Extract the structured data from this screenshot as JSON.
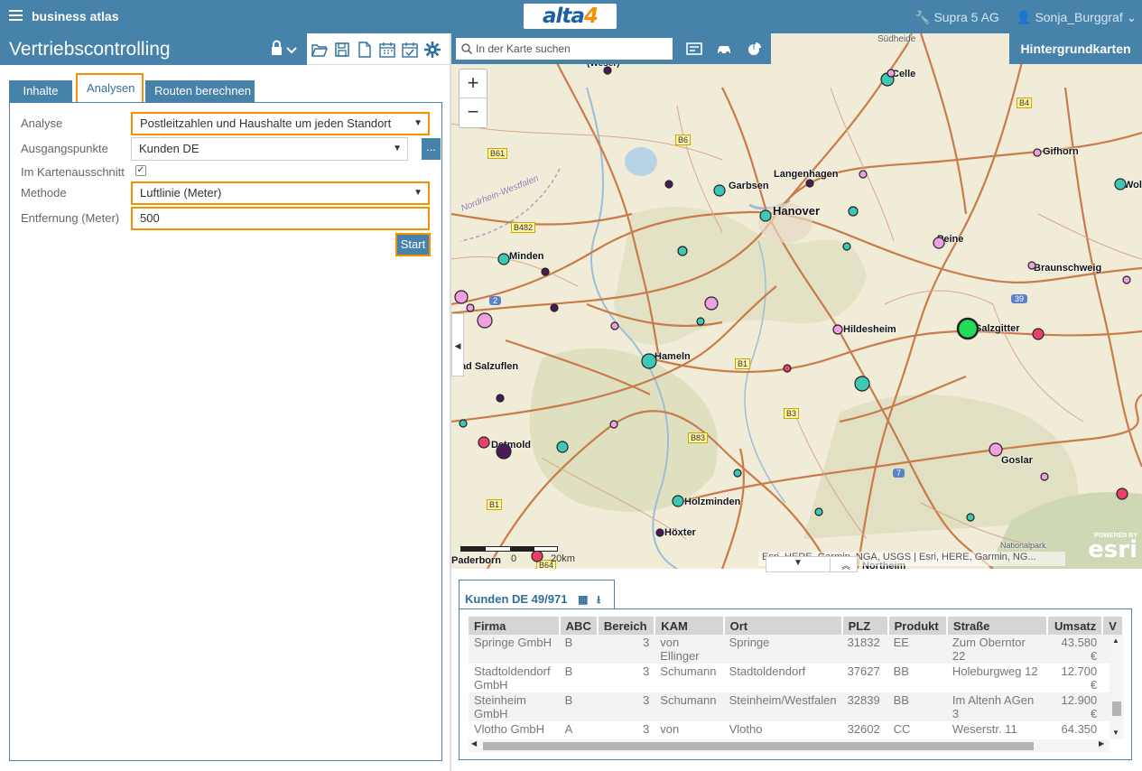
{
  "app": {
    "brand": "business atlas",
    "logo_text": "alta",
    "logo_digit": "4",
    "org": "Supra 5 AG",
    "user": "Sonja_Burggraf"
  },
  "left": {
    "title": "Vertriebscontrolling",
    "tabs": [
      "Inhalte",
      "Analysen",
      "Routen berechnen"
    ],
    "active_tab": "Analysen",
    "form": {
      "analyse_label": "Analyse",
      "analyse_value": "Postleitzahlen und Haushalte um jeden Standort",
      "ausgangspunkte_label": "Ausgangspunkte",
      "ausgangspunkte_value": "Kunden DE",
      "more_label": "...",
      "kartenausschnitt_label": "Im Kartenausschnitt",
      "kartenausschnitt_checked": true,
      "methode_label": "Methode",
      "methode_value": "Luftlinie (Meter)",
      "entfernung_label": "Entfernung (Meter)",
      "entfernung_value": "500",
      "start_label": "Start"
    }
  },
  "map": {
    "search_placeholder": "In der Karte suchen",
    "basemap_label": "Hintergrundkarten",
    "zoom_in": "+",
    "zoom_out": "−",
    "attribution": "Esri, HERE, Garmin, NGA, USGS | Esri, HERE, Garmin, NG...",
    "esri_powered": "POWERED BY",
    "esri_word": "esri",
    "scale_label_left": "0",
    "scale_label_right": "20km",
    "labels": {
      "weser": "(Weser)",
      "celle": "Celle",
      "suedheide": "Südheide",
      "gifhorn": "Gifhorn",
      "wolfsburg": "Wolfsburg",
      "garbsen": "Garbsen",
      "langenhagen": "Langenhagen",
      "hannover": "Hanover",
      "peine": "Peine",
      "braunschweig": "Braunschweig",
      "minden": "Minden",
      "hildesheim": "Hildesheim",
      "salzgitter": "Salzgitter",
      "hameln": "Hameln",
      "badsalzuflen": "Bad Salzuflen",
      "detmold": "Detmold",
      "goslar": "Goslar",
      "holzminden": "Holzminden",
      "hoexter": "Höxter",
      "paderborn": "Paderborn",
      "nationalpark": "Nationalpark",
      "northeim": "Northeim",
      "nrw_westfalen": "Nordrhein-Westfalen"
    },
    "shields": [
      "B61",
      "B6",
      "B482",
      "B1",
      "B3",
      "B83",
      "B1",
      "B64",
      "B4"
    ],
    "autobahn": [
      "2",
      "39",
      "7"
    ],
    "marker_colors": {
      "teal": "#3cc8b4",
      "pink": "#f0a0e0",
      "purple": "#4a1a5a",
      "red": "#e8406a",
      "green": "#22dd55"
    }
  },
  "table": {
    "tab_label": "Kunden DE 49/971",
    "columns": [
      "Firma",
      "ABC",
      "Bereich",
      "KAM",
      "Ort",
      "PLZ",
      "Produkt",
      "Straße",
      "Umsatz",
      "V"
    ],
    "rows": [
      [
        "Springe GmbH",
        "B",
        "3",
        "von Ellinger",
        "Springe",
        "31832",
        "EE",
        "Zum Oberntor 22",
        "43.580 €"
      ],
      [
        "Stadtoldendorf GmbH",
        "B",
        "3",
        "Schumann",
        "Stadtoldendorf",
        "37627",
        "BB",
        "Holeburgweg 12",
        "12.700 €"
      ],
      [
        "Steinheim GmbH",
        "B",
        "3",
        "Schumann",
        "Steinheim/Westfalen",
        "32839",
        "BB",
        "Im Altenh AGen 3",
        "12.900 €"
      ],
      [
        "Vlotho GmbH",
        "A",
        "3",
        "von",
        "Vlotho",
        "32602",
        "CC",
        "Weserstr. 11",
        "64.350"
      ]
    ]
  }
}
